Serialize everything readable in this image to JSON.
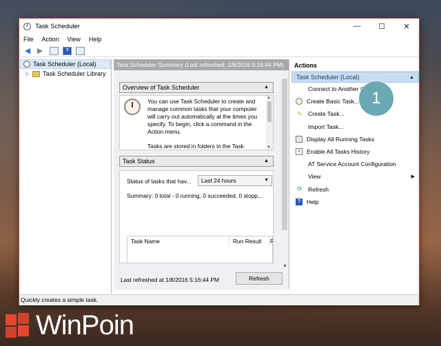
{
  "window": {
    "title": "Task Scheduler",
    "controls": [
      "—",
      "☐",
      "✕"
    ]
  },
  "menu": [
    "File",
    "Action",
    "View",
    "Help"
  ],
  "toolbar": {
    "back_icon": "back-arrow-icon",
    "forward_icon": "forward-arrow-icon",
    "help_glyph": "?"
  },
  "tree": [
    {
      "label": "Task Scheduler (Local)",
      "icon": "clock-icon",
      "selected": true
    },
    {
      "label": "Task Scheduler Library",
      "icon": "folder-icon",
      "selected": false
    }
  ],
  "center": {
    "summary_bar": "Task Scheduler Summary (Last refreshed: 1/8/2016 5:16:44 PM)",
    "overview": {
      "header": "Overview of Task Scheduler",
      "text1": "You can use Task Scheduler to create and manage common tasks that your computer will carry out automatically at the times you specify. To begin, click a command in the Action menu.",
      "text2": "Tasks are stored in folders in the Task"
    },
    "status": {
      "header": "Task Status",
      "label": "Status of tasks that hav...",
      "select_value": "Last 24 hours",
      "summary": "Summary: 0 total - 0 running, 0 succeeded, 0 stopp...",
      "columns": [
        "Task Name",
        "Run Result",
        "R"
      ]
    },
    "last_refreshed": "Last refreshed at 1/8/2016 5:16:44 PM",
    "refresh_button": "Refresh"
  },
  "actions": {
    "header": "Actions",
    "group": "Task Scheduler (Local)",
    "items": [
      {
        "label": "Connect to Another Computer...",
        "icon": ""
      },
      {
        "label": "Create Basic Task...",
        "icon": "task-wizard-icon"
      },
      {
        "label": "Create Task...",
        "icon": "new-task-icon"
      },
      {
        "label": "Import Task...",
        "icon": ""
      },
      {
        "label": "Display All Running Tasks",
        "icon": "running-tasks-icon"
      },
      {
        "label": "Enable All Tasks History",
        "icon": "history-icon"
      },
      {
        "label": "AT Service Account Configuration",
        "icon": ""
      },
      {
        "label": "View",
        "icon": "",
        "submenu": true
      },
      {
        "label": "Refresh",
        "icon": "refresh-icon"
      },
      {
        "label": "Help",
        "icon": "help-icon"
      }
    ]
  },
  "status_bar": "Quickly creates a simple task.",
  "annotation_badge": "1",
  "watermark": "WinPoin",
  "colors": {
    "accent_border": "#c8483e",
    "selection": "#c7dcf2",
    "badge": "#6aa8b4"
  }
}
